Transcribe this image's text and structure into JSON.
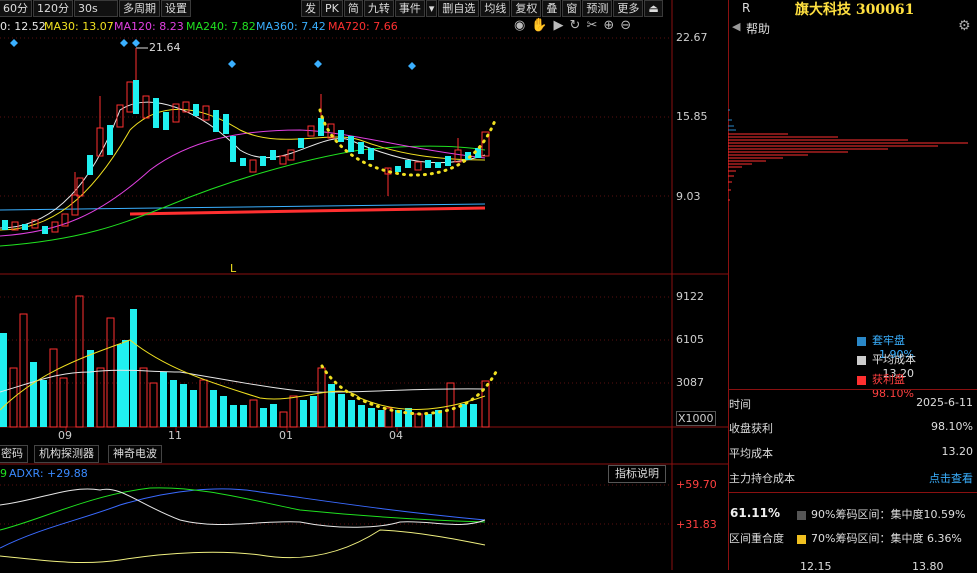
{
  "toolbar_left": [
    "60分",
    "120分",
    "30s",
    "多周期",
    "设置"
  ],
  "toolbar_right": [
    "发",
    "PK",
    "简",
    "九转",
    "事件",
    "删自选",
    "均线",
    "复权",
    "叠",
    "窗",
    "预测",
    "更多"
  ],
  "ma_legend": [
    {
      "text": "0: 12.52",
      "color": "#e7e7e7"
    },
    {
      "text": "MA30: 13.07",
      "color": "#f0e020"
    },
    {
      "text": "MA120: 8.23",
      "color": "#e040e0"
    },
    {
      "text": "MA240: 7.82",
      "color": "#20e020"
    },
    {
      "text": "MA360: 7.42",
      "color": "#3ab0ff"
    },
    {
      "text": "MA720: 7.66",
      "color": "#ff3030"
    }
  ],
  "peak_label": "21.64",
  "l_marker": "L",
  "price_axis": [
    "22.67",
    "15.85",
    "9.03"
  ],
  "volume_axis": [
    "9122",
    "6105",
    "3087"
  ],
  "volume_unit": "X1000",
  "month_labels": [
    "09",
    "11",
    "01",
    "04"
  ],
  "bottom_tabs": [
    "密码",
    "机构探测器",
    "神奇电波"
  ],
  "indicator": {
    "prefix": "9",
    "adxr": "ADXR: +29.88",
    "button": "指标说明",
    "levels": [
      "+59.70",
      "+31.83"
    ]
  },
  "right_panel": {
    "r_mark": "R",
    "stock": "旗大科技 300061",
    "help": "帮助",
    "legend": [
      {
        "label": "套牢盘",
        "value": "1.90%",
        "color": "#2a88c8",
        "text_color": "#3ab0ff"
      },
      {
        "label": "平均成本",
        "value": "13.20",
        "color": "#cccccc",
        "text_color": "#dddddd"
      },
      {
        "label": "获利盘",
        "value": "98.10%",
        "color": "#ff3030",
        "text_color": "#ff4040"
      }
    ],
    "rows": [
      {
        "label": "时间",
        "value": "2025-6-11"
      },
      {
        "label": "收盘获利",
        "value": "98.10%"
      },
      {
        "label": "平均成本",
        "value": "13.20"
      },
      {
        "label": "主力持仓成本",
        "value": "点击查看"
      }
    ],
    "concentration": {
      "pct": "61.11%",
      "overlap": "区间重合度",
      "r90": "90%筹码区间：集中度10.59%",
      "r70": "70%筹码区间：集中度 6.36%",
      "bottom_left": "12.15",
      "bottom_right": "13.80"
    }
  },
  "chart_data": {
    "type": "candlestick",
    "price_ticks": [
      22.67,
      15.85,
      9.03
    ],
    "volume_ticks": [
      9122,
      6105,
      3087
    ],
    "peak_high": 21.64,
    "ma_values": {
      "MA30": 13.07,
      "MA120": 8.23,
      "MA240": 7.82,
      "MA360": 7.42,
      "MA720": 7.66
    },
    "colors": {
      "up": "#ff3030",
      "down": "#20f0f0"
    }
  }
}
